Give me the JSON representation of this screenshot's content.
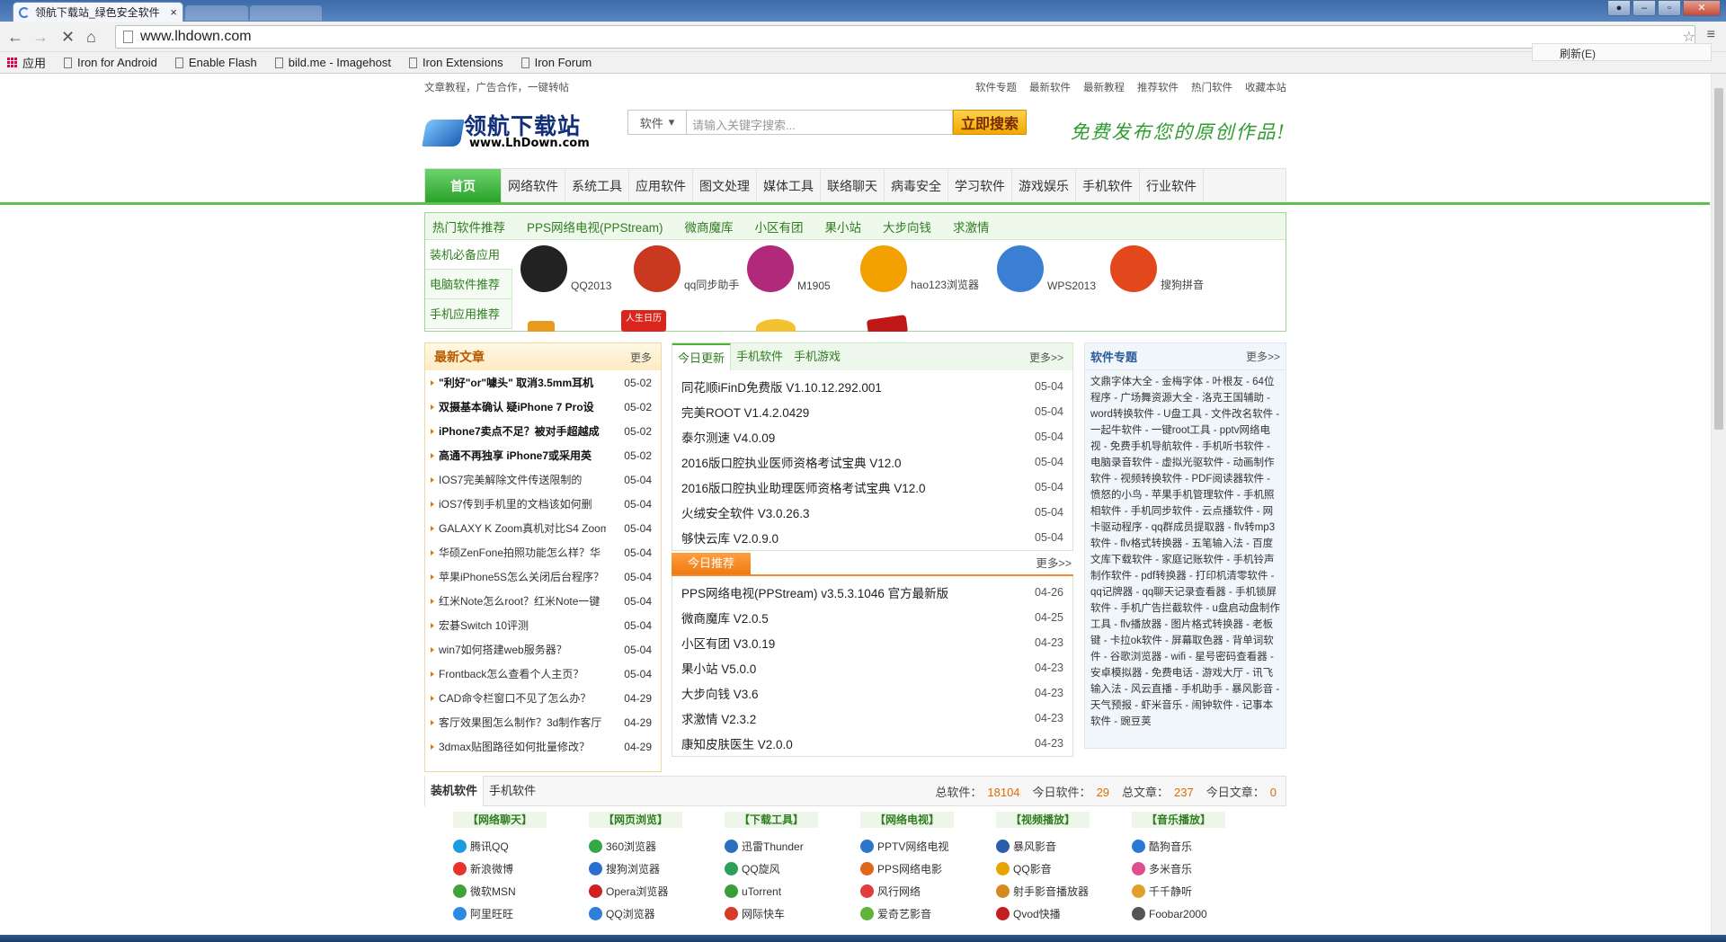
{
  "browser": {
    "tab_title": "领航下载站_绿色安全软件",
    "tab_close": "×",
    "url": "www.lhdown.com",
    "refresh_menu": "刷新(E)",
    "bookmarks": [
      "应用",
      "Iron for Android",
      "Enable Flash",
      "bild.me - Imagehost",
      "Iron Extensions",
      "Iron Forum"
    ]
  },
  "site": {
    "top_left": "文章教程，广告合作，一键转帖",
    "top_links": [
      "软件专题",
      "最新软件",
      "最新教程",
      "推荐软件",
      "热门软件",
      "收藏本站"
    ],
    "logo_cn": "领航下载站",
    "logo_en": "www.LhDown.com",
    "search_category": "软件",
    "search_placeholder": "请输入关键字搜索...",
    "search_button": "立即搜索",
    "slogan": "免费发布您的原创作品!",
    "nav": [
      "首页",
      "网络软件",
      "系统工具",
      "应用软件",
      "图文处理",
      "媒体工具",
      "联络聊天",
      "病毒安全",
      "学习软件",
      "游戏娱乐",
      "手机软件",
      "行业软件"
    ]
  },
  "hot": {
    "bar": [
      "热门软件推荐",
      "PPS网络电视(PPStream)",
      "微商魔库",
      "小区有团",
      "果小站",
      "大步向钱",
      "求激情"
    ],
    "side_tabs": [
      "装机必备应用",
      "电脑软件推荐",
      "手机应用推荐"
    ],
    "apps": [
      {
        "name": "QQ2013",
        "color": "#222222"
      },
      {
        "name": "qq同步助手",
        "color": "#c8391f"
      },
      {
        "name": "M1905",
        "color": "#b0297a"
      },
      {
        "name": "hao123浏览器",
        "color": "#f2a100"
      },
      {
        "name": "WPS2013",
        "color": "#3a7fd4"
      },
      {
        "name": "搜狗拼音",
        "color": "#e2481c"
      }
    ],
    "second_row_badge": "人生日历"
  },
  "articles": {
    "title": "最新文章",
    "more": "更多",
    "items": [
      {
        "t": "\"利好\"or\"噱头\" 取消3.5mm耳机",
        "d": "05-02",
        "b": true
      },
      {
        "t": "双摄基本确认 疑iPhone 7 Pro设",
        "d": "05-02",
        "b": true
      },
      {
        "t": "iPhone7卖点不足？被对手超越成",
        "d": "05-02",
        "b": true
      },
      {
        "t": "高通不再独享 iPhone7或采用英",
        "d": "05-02",
        "b": true
      },
      {
        "t": "IOS7完美解除文件传送限制的",
        "d": "05-04",
        "b": false
      },
      {
        "t": "iOS7传到手机里的文档该如何删",
        "d": "05-04",
        "b": false
      },
      {
        "t": "GALAXY K Zoom真机对比S4 Zoom",
        "d": "05-04",
        "b": false
      },
      {
        "t": "华硕ZenFone拍照功能怎么样？华",
        "d": "05-04",
        "b": false
      },
      {
        "t": "苹果iPhone5S怎么关闭后台程序？",
        "d": "05-04",
        "b": false
      },
      {
        "t": "红米Note怎么root？红米Note一键",
        "d": "05-04",
        "b": false
      },
      {
        "t": "宏碁Switch 10评测",
        "d": "05-04",
        "b": false
      },
      {
        "t": "win7如何搭建web服务器？",
        "d": "05-04",
        "b": false
      },
      {
        "t": "Frontback怎么查看个人主页？",
        "d": "05-04",
        "b": false
      },
      {
        "t": "CAD命令栏窗口不见了怎么办？",
        "d": "04-29",
        "b": false
      },
      {
        "t": "客厅效果图怎么制作？3d制作客厅",
        "d": "04-29",
        "b": false
      },
      {
        "t": "3dmax贴图路径如何批量修改？",
        "d": "04-29",
        "b": false
      }
    ]
  },
  "updates": {
    "tabs": [
      "今日更新",
      "手机软件",
      "手机游戏"
    ],
    "more": "更多>>",
    "items": [
      {
        "t": "同花顺iFinD免费版 V1.10.12.292.001",
        "d": "05-04"
      },
      {
        "t": "完美ROOT V1.4.2.0429",
        "d": "05-04"
      },
      {
        "t": "泰尔测速 V4.0.09",
        "d": "05-04"
      },
      {
        "t": "2016版口腔执业医师资格考试宝典 V12.0",
        "d": "05-04"
      },
      {
        "t": "2016版口腔执业助理医师资格考试宝典 V12.0",
        "d": "05-04"
      },
      {
        "t": "火绒安全软件 V3.0.26.3",
        "d": "05-04"
      },
      {
        "t": "够快云库 V2.0.9.0",
        "d": "05-04"
      }
    ],
    "rec_label": "今日推荐",
    "rec_more": "更多>>",
    "rec_items": [
      {
        "t": "PPS网络电视(PPStream) v3.5.3.1046 官方最新版",
        "d": "04-26"
      },
      {
        "t": "微商魔库 V2.0.5",
        "d": "04-25"
      },
      {
        "t": "小区有团 V3.0.19",
        "d": "04-23"
      },
      {
        "t": "果小站 V5.0.0",
        "d": "04-23"
      },
      {
        "t": "大步向钱 V3.6",
        "d": "04-23"
      },
      {
        "t": "求激情 V2.3.2",
        "d": "04-23"
      },
      {
        "t": "康知皮肤医生 V2.0.0",
        "d": "04-23"
      }
    ]
  },
  "topics": {
    "title": "软件专题",
    "more": "更多>>",
    "text": "文鼎字体大全 - 金梅字体 - 叶根友 - 64位程序 - 广场舞资源大全 - 洛克王国辅助 - word转换软件 - U盘工具 - 文件改名软件 - 一起牛软件 - 一键root工具 - pptv网络电视 - 免费手机导航软件 - 手机听书软件 - 电脑录音软件 - 虚拟光驱软件 - 动画制作软件 - 视频转换软件 - PDF阅读器软件 - 愤怒的小鸟 - 苹果手机管理软件 - 手机照相软件 - 手机同步软件 - 云点播软件 - 网卡驱动程序 - qq群成员提取器 - flv转mp3软件 - flv格式转换器 - 五笔输入法 - 百度文库下载软件 - 家庭记账软件 - 手机铃声制作软件 - pdf转换器 - 打印机清零软件 - qq记牌器 - qq聊天记录查看器 - 手机锁屏软件 - 手机广告拦截软件 - u盘启动盘制作工具 - flv播放器 - 图片格式转换器 - 老板键 - 卡拉ok软件 - 屏幕取色器 - 背单词软件 - 谷歌浏览器 - wifi - 星号密码查看器 - 安卓模拟器 - 免费电话 - 游戏大厅 - 讯飞输入法 - 风云直播 - 手机助手 - 暴风影音 - 天气预报 - 虾米音乐 - 闹钟软件 - 记事本软件 - 豌豆荚"
  },
  "stats": {
    "tabs": [
      "装机软件",
      "手机软件"
    ],
    "labels": [
      "总软件：",
      "今日软件：",
      "总文章：",
      "今日文章："
    ],
    "values": [
      "18104",
      "29",
      "237",
      "0"
    ]
  },
  "categories": [
    {
      "title": "【网络聊天】",
      "items": [
        {
          "n": "腾讯QQ",
          "c": "#1d9be0"
        },
        {
          "n": "新浪微博",
          "c": "#e8332d"
        },
        {
          "n": "微软MSN",
          "c": "#3fa33a"
        },
        {
          "n": "阿里旺旺",
          "c": "#2d89e6"
        }
      ]
    },
    {
      "title": "【网页浏览】",
      "items": [
        {
          "n": "360浏览器",
          "c": "#35a84a"
        },
        {
          "n": "搜狗浏览器",
          "c": "#2a6fd0"
        },
        {
          "n": "Opera浏览器",
          "c": "#d21f1f"
        },
        {
          "n": "QQ浏览器",
          "c": "#2f7fd6"
        }
      ]
    },
    {
      "title": "【下载工具】",
      "items": [
        {
          "n": "迅雷Thunder",
          "c": "#2b6fbf"
        },
        {
          "n": "QQ旋风",
          "c": "#2aa05b"
        },
        {
          "n": "uTorrent",
          "c": "#3a9e36"
        },
        {
          "n": "网际快车",
          "c": "#d83a2a"
        }
      ]
    },
    {
      "title": "【网络电视】",
      "items": [
        {
          "n": "PPTV网络电视",
          "c": "#2d76c9"
        },
        {
          "n": "PPS网络电影",
          "c": "#e0661a"
        },
        {
          "n": "风行网络",
          "c": "#e03d3d"
        },
        {
          "n": "爱奇艺影音",
          "c": "#60b33a"
        }
      ]
    },
    {
      "title": "【视频播放】",
      "items": [
        {
          "n": "暴风影音",
          "c": "#2a5ea8"
        },
        {
          "n": "QQ影音",
          "c": "#e6a400"
        },
        {
          "n": "射手影音播放器",
          "c": "#d68a1e"
        },
        {
          "n": "Qvod快播",
          "c": "#c41f1f"
        }
      ]
    },
    {
      "title": "【音乐播放】",
      "items": [
        {
          "n": "酷狗音乐",
          "c": "#2a78d6"
        },
        {
          "n": "多米音乐",
          "c": "#e04d8f"
        },
        {
          "n": "千千静听",
          "c": "#e0a02a"
        },
        {
          "n": "Foobar2000",
          "c": "#555555"
        }
      ]
    }
  ]
}
